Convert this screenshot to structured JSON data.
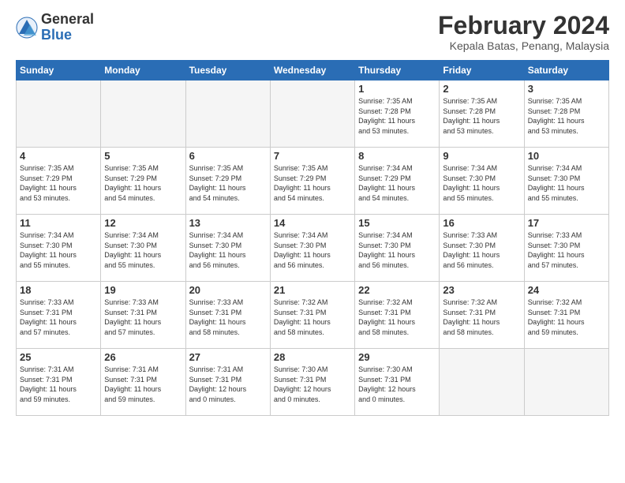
{
  "logo": {
    "general": "General",
    "blue": "Blue"
  },
  "title": "February 2024",
  "subtitle": "Kepala Batas, Penang, Malaysia",
  "days_of_week": [
    "Sunday",
    "Monday",
    "Tuesday",
    "Wednesday",
    "Thursday",
    "Friday",
    "Saturday"
  ],
  "weeks": [
    [
      {
        "day": "",
        "info": ""
      },
      {
        "day": "",
        "info": ""
      },
      {
        "day": "",
        "info": ""
      },
      {
        "day": "",
        "info": ""
      },
      {
        "day": "1",
        "info": "Sunrise: 7:35 AM\nSunset: 7:28 PM\nDaylight: 11 hours\nand 53 minutes."
      },
      {
        "day": "2",
        "info": "Sunrise: 7:35 AM\nSunset: 7:28 PM\nDaylight: 11 hours\nand 53 minutes."
      },
      {
        "day": "3",
        "info": "Sunrise: 7:35 AM\nSunset: 7:28 PM\nDaylight: 11 hours\nand 53 minutes."
      }
    ],
    [
      {
        "day": "4",
        "info": "Sunrise: 7:35 AM\nSunset: 7:29 PM\nDaylight: 11 hours\nand 53 minutes."
      },
      {
        "day": "5",
        "info": "Sunrise: 7:35 AM\nSunset: 7:29 PM\nDaylight: 11 hours\nand 54 minutes."
      },
      {
        "day": "6",
        "info": "Sunrise: 7:35 AM\nSunset: 7:29 PM\nDaylight: 11 hours\nand 54 minutes."
      },
      {
        "day": "7",
        "info": "Sunrise: 7:35 AM\nSunset: 7:29 PM\nDaylight: 11 hours\nand 54 minutes."
      },
      {
        "day": "8",
        "info": "Sunrise: 7:34 AM\nSunset: 7:29 PM\nDaylight: 11 hours\nand 54 minutes."
      },
      {
        "day": "9",
        "info": "Sunrise: 7:34 AM\nSunset: 7:30 PM\nDaylight: 11 hours\nand 55 minutes."
      },
      {
        "day": "10",
        "info": "Sunrise: 7:34 AM\nSunset: 7:30 PM\nDaylight: 11 hours\nand 55 minutes."
      }
    ],
    [
      {
        "day": "11",
        "info": "Sunrise: 7:34 AM\nSunset: 7:30 PM\nDaylight: 11 hours\nand 55 minutes."
      },
      {
        "day": "12",
        "info": "Sunrise: 7:34 AM\nSunset: 7:30 PM\nDaylight: 11 hours\nand 55 minutes."
      },
      {
        "day": "13",
        "info": "Sunrise: 7:34 AM\nSunset: 7:30 PM\nDaylight: 11 hours\nand 56 minutes."
      },
      {
        "day": "14",
        "info": "Sunrise: 7:34 AM\nSunset: 7:30 PM\nDaylight: 11 hours\nand 56 minutes."
      },
      {
        "day": "15",
        "info": "Sunrise: 7:34 AM\nSunset: 7:30 PM\nDaylight: 11 hours\nand 56 minutes."
      },
      {
        "day": "16",
        "info": "Sunrise: 7:33 AM\nSunset: 7:30 PM\nDaylight: 11 hours\nand 56 minutes."
      },
      {
        "day": "17",
        "info": "Sunrise: 7:33 AM\nSunset: 7:30 PM\nDaylight: 11 hours\nand 57 minutes."
      }
    ],
    [
      {
        "day": "18",
        "info": "Sunrise: 7:33 AM\nSunset: 7:31 PM\nDaylight: 11 hours\nand 57 minutes."
      },
      {
        "day": "19",
        "info": "Sunrise: 7:33 AM\nSunset: 7:31 PM\nDaylight: 11 hours\nand 57 minutes."
      },
      {
        "day": "20",
        "info": "Sunrise: 7:33 AM\nSunset: 7:31 PM\nDaylight: 11 hours\nand 58 minutes."
      },
      {
        "day": "21",
        "info": "Sunrise: 7:32 AM\nSunset: 7:31 PM\nDaylight: 11 hours\nand 58 minutes."
      },
      {
        "day": "22",
        "info": "Sunrise: 7:32 AM\nSunset: 7:31 PM\nDaylight: 11 hours\nand 58 minutes."
      },
      {
        "day": "23",
        "info": "Sunrise: 7:32 AM\nSunset: 7:31 PM\nDaylight: 11 hours\nand 58 minutes."
      },
      {
        "day": "24",
        "info": "Sunrise: 7:32 AM\nSunset: 7:31 PM\nDaylight: 11 hours\nand 59 minutes."
      }
    ],
    [
      {
        "day": "25",
        "info": "Sunrise: 7:31 AM\nSunset: 7:31 PM\nDaylight: 11 hours\nand 59 minutes."
      },
      {
        "day": "26",
        "info": "Sunrise: 7:31 AM\nSunset: 7:31 PM\nDaylight: 11 hours\nand 59 minutes."
      },
      {
        "day": "27",
        "info": "Sunrise: 7:31 AM\nSunset: 7:31 PM\nDaylight: 12 hours\nand 0 minutes."
      },
      {
        "day": "28",
        "info": "Sunrise: 7:30 AM\nSunset: 7:31 PM\nDaylight: 12 hours\nand 0 minutes."
      },
      {
        "day": "29",
        "info": "Sunrise: 7:30 AM\nSunset: 7:31 PM\nDaylight: 12 hours\nand 0 minutes."
      },
      {
        "day": "",
        "info": ""
      },
      {
        "day": "",
        "info": ""
      }
    ]
  ]
}
